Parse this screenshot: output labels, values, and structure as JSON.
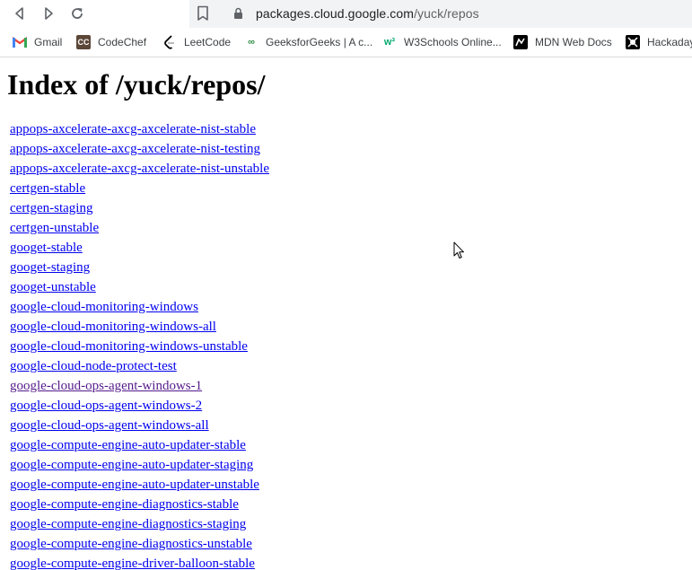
{
  "browser": {
    "url_host": "packages.cloud.google.com",
    "url_path": "/yuck/repos"
  },
  "bookmarks": [
    {
      "label": "Gmail",
      "icon": "gmail-icon"
    },
    {
      "label": "CodeChef",
      "icon": "codechef-icon"
    },
    {
      "label": "LeetCode",
      "icon": "leetcode-icon"
    },
    {
      "label": "GeeksforGeeks | A c...",
      "icon": "geeksforgeeks-icon"
    },
    {
      "label": "W3Schools Online...",
      "icon": "w3schools-icon"
    },
    {
      "label": "MDN Web Docs",
      "icon": "mdn-icon"
    },
    {
      "label": "Hackaday",
      "icon": "hackaday-icon"
    }
  ],
  "page": {
    "title": "Index of /yuck/repos/",
    "links": [
      "appops-axcelerate-axcg-axcelerate-nist-stable",
      "appops-axcelerate-axcg-axcelerate-nist-testing",
      "appops-axcelerate-axcg-axcelerate-nist-unstable",
      "certgen-stable",
      "certgen-staging",
      "certgen-unstable",
      "googet-stable",
      "googet-staging",
      "googet-unstable",
      "google-cloud-monitoring-windows",
      "google-cloud-monitoring-windows-all",
      "google-cloud-monitoring-windows-unstable",
      "google-cloud-node-protect-test",
      "google-cloud-ops-agent-windows-1",
      "google-cloud-ops-agent-windows-2",
      "google-cloud-ops-agent-windows-all",
      "google-compute-engine-auto-updater-stable",
      "google-compute-engine-auto-updater-staging",
      "google-compute-engine-auto-updater-unstable",
      "google-compute-engine-diagnostics-stable",
      "google-compute-engine-diagnostics-staging",
      "google-compute-engine-diagnostics-unstable",
      "google-compute-engine-driver-balloon-stable"
    ],
    "visited_link": "google-cloud-ops-agent-windows-1"
  },
  "colors": {
    "link": "#0000ee",
    "visited_link": "#551a8b",
    "omnibox_bg": "#f1f3f4"
  }
}
